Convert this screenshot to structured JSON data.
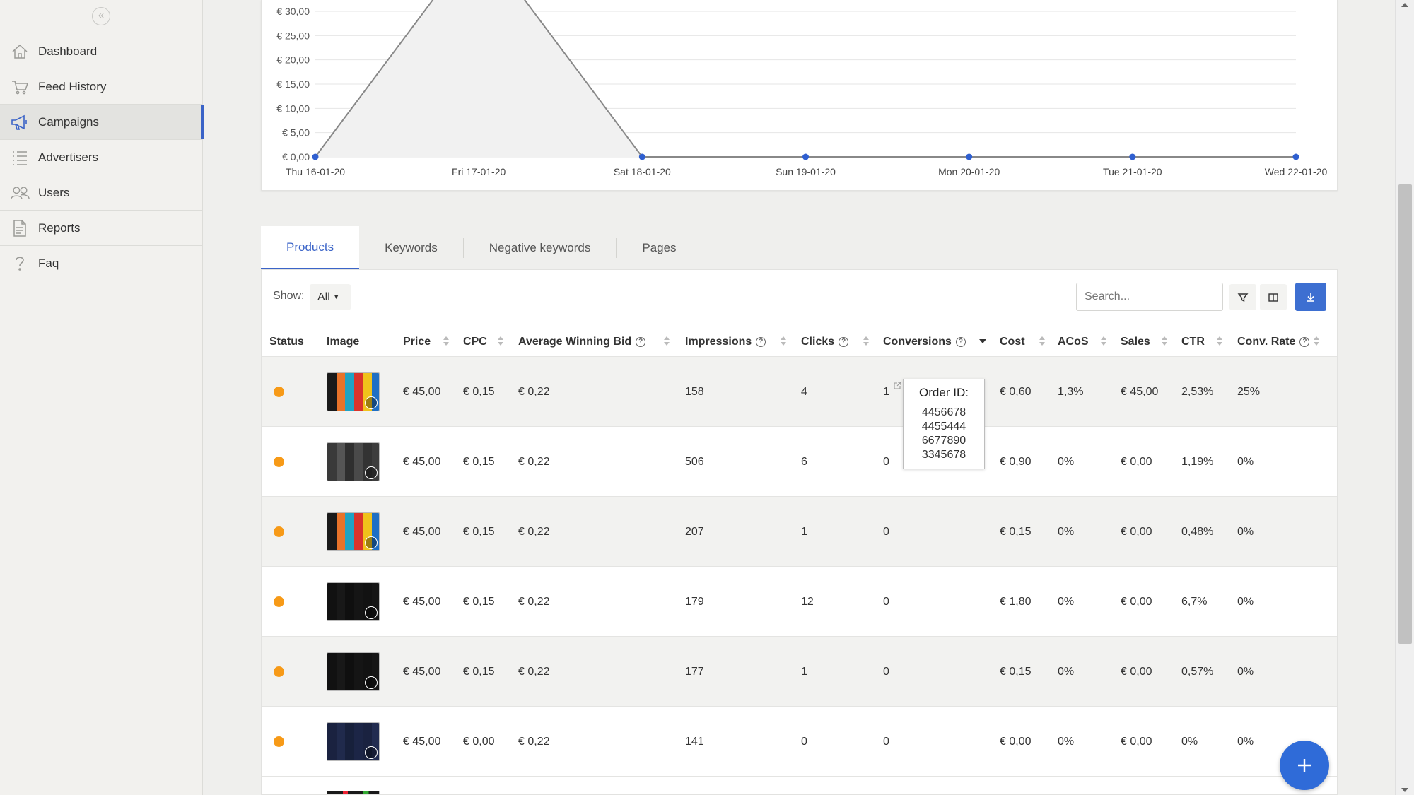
{
  "sidebar": {
    "collapse_icon": "«",
    "items": [
      {
        "label": "Dashboard",
        "icon": "home-icon"
      },
      {
        "label": "Feed History",
        "icon": "cart-icon"
      },
      {
        "label": "Campaigns",
        "icon": "megaphone-icon",
        "active": true
      },
      {
        "label": "Advertisers",
        "icon": "list-icon"
      },
      {
        "label": "Users",
        "icon": "users-icon"
      },
      {
        "label": "Reports",
        "icon": "report-icon"
      },
      {
        "label": "Faq",
        "icon": "question-icon"
      }
    ]
  },
  "chart_data": {
    "type": "area",
    "categories": [
      "Thu 16-01-20",
      "Fri 17-01-20",
      "Sat 18-01-20",
      "Sun 19-01-20",
      "Mon 20-01-20",
      "Tue 21-01-20",
      "Wed 22-01-20"
    ],
    "series": [
      {
        "values": [
          0,
          45,
          0,
          0,
          0,
          0,
          0
        ]
      }
    ],
    "y_ticks": [
      "€ 0,00",
      "€ 5,00",
      "€ 10,00",
      "€ 15,00",
      "€ 20,00",
      "€ 25,00",
      "€ 30,00"
    ],
    "ylim": [
      0,
      30
    ],
    "grid": true,
    "colors": {
      "line": "#888888",
      "fill": "#f1f1f1",
      "points": "#2f5fd0"
    }
  },
  "tabs": [
    "Products",
    "Keywords",
    "Negative keywords",
    "Pages"
  ],
  "toolbar": {
    "show_label": "Show:",
    "show_value": "All",
    "search_placeholder": "Search...",
    "filter_icon": "filter-icon",
    "columns_icon": "columns-icon",
    "export_icon": "download-icon"
  },
  "table": {
    "headers": [
      "Status",
      "Image",
      "Price",
      "CPC",
      "Average Winning Bid",
      "Impressions",
      "Clicks",
      "Conversions",
      "Cost",
      "ACoS",
      "Sales",
      "CTR",
      "Conv. Rate"
    ],
    "rows": [
      {
        "price": "€ 45,00",
        "cpc": "€ 0,15",
        "awb": "€ 0,22",
        "impressions": "158",
        "clicks": "4",
        "conversions": "1",
        "cost": "€ 0,60",
        "acos": "1,3%",
        "sales": "€ 45,00",
        "ctr": "2,53%",
        "conv_rate": "25%"
      },
      {
        "price": "€ 45,00",
        "cpc": "€ 0,15",
        "awb": "€ 0,22",
        "impressions": "506",
        "clicks": "6",
        "conversions": "0",
        "cost": "€ 0,90",
        "acos": "0%",
        "sales": "€ 0,00",
        "ctr": "1,19%",
        "conv_rate": "0%"
      },
      {
        "price": "€ 45,00",
        "cpc": "€ 0,15",
        "awb": "€ 0,22",
        "impressions": "207",
        "clicks": "1",
        "conversions": "0",
        "cost": "€ 0,15",
        "acos": "0%",
        "sales": "€ 0,00",
        "ctr": "0,48%",
        "conv_rate": "0%"
      },
      {
        "price": "€ 45,00",
        "cpc": "€ 0,15",
        "awb": "€ 0,22",
        "impressions": "179",
        "clicks": "12",
        "conversions": "0",
        "cost": "€ 1,80",
        "acos": "0%",
        "sales": "€ 0,00",
        "ctr": "6,7%",
        "conv_rate": "0%"
      },
      {
        "price": "€ 45,00",
        "cpc": "€ 0,15",
        "awb": "€ 0,22",
        "impressions": "177",
        "clicks": "1",
        "conversions": "0",
        "cost": "€ 0,15",
        "acos": "0%",
        "sales": "€ 0,00",
        "ctr": "0,57%",
        "conv_rate": "0%"
      },
      {
        "price": "€ 45,00",
        "cpc": "€ 0,00",
        "awb": "€ 0,22",
        "impressions": "141",
        "clicks": "0",
        "conversions": "0",
        "cost": "€ 0,00",
        "acos": "0%",
        "sales": "€ 0,00",
        "ctr": "0%",
        "conv_rate": "0%"
      }
    ]
  },
  "tooltip": {
    "title": "Order ID:",
    "order_ids": [
      "4456678",
      "4455444",
      "6677890",
      "3345678"
    ]
  },
  "fab_icon": "plus-icon"
}
